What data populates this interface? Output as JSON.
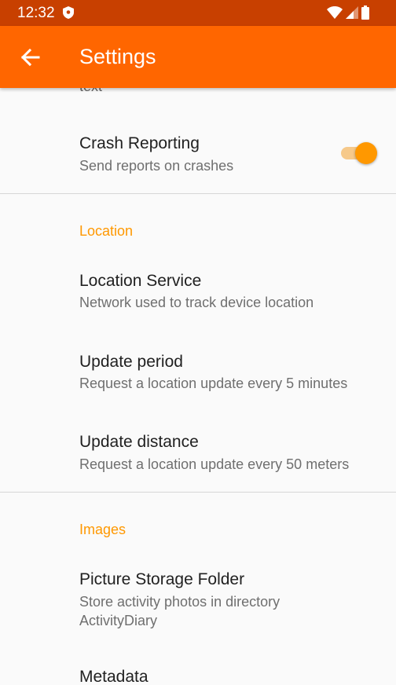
{
  "status_bar": {
    "time": "12:32"
  },
  "app_bar": {
    "title": "Settings"
  },
  "top_clipped_text": "text",
  "crash_reporting": {
    "title": "Crash Reporting",
    "summary": "Send reports on crashes",
    "enabled": true
  },
  "location": {
    "header": "Location",
    "items": [
      {
        "title": "Location Service",
        "summary": "Network used to track device location"
      },
      {
        "title": "Update period",
        "summary": "Request a location update every 5 minutes"
      },
      {
        "title": "Update distance",
        "summary": "Request a location update every 50 meters"
      }
    ]
  },
  "images": {
    "header": "Images",
    "items": [
      {
        "title": "Picture Storage Folder",
        "summary": "Store activity photos in directory ActivityDiary"
      },
      {
        "title": "Metadata",
        "summary": ""
      }
    ]
  },
  "colors": {
    "status_bar": "#c84000",
    "app_bar": "#ff6600",
    "accent": "#ff9800"
  }
}
